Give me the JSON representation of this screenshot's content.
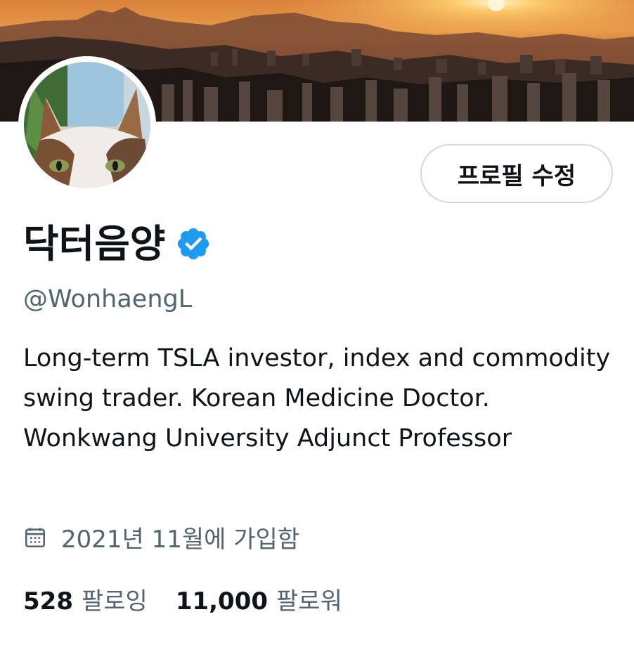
{
  "profile": {
    "display_name": "닥터음양",
    "handle": "@WonhaengL",
    "bio": "Long-term TSLA investor, index and commodity swing trader. Korean Medicine Doctor. Wonkwang University Adjunct Professor",
    "joined": "2021년 11월에 가입함",
    "verified": true
  },
  "actions": {
    "edit_profile_label": "프로필 수정"
  },
  "stats": {
    "following_count": "528",
    "following_label": "팔로잉",
    "followers_count": "11,000",
    "followers_label": "팔로워"
  },
  "colors": {
    "verified_blue": "#1d9bf0",
    "secondary_text": "#536471",
    "border": "#cfd9de"
  },
  "icons": {
    "verified": "verified-badge-icon",
    "joined": "calendar-icon"
  }
}
